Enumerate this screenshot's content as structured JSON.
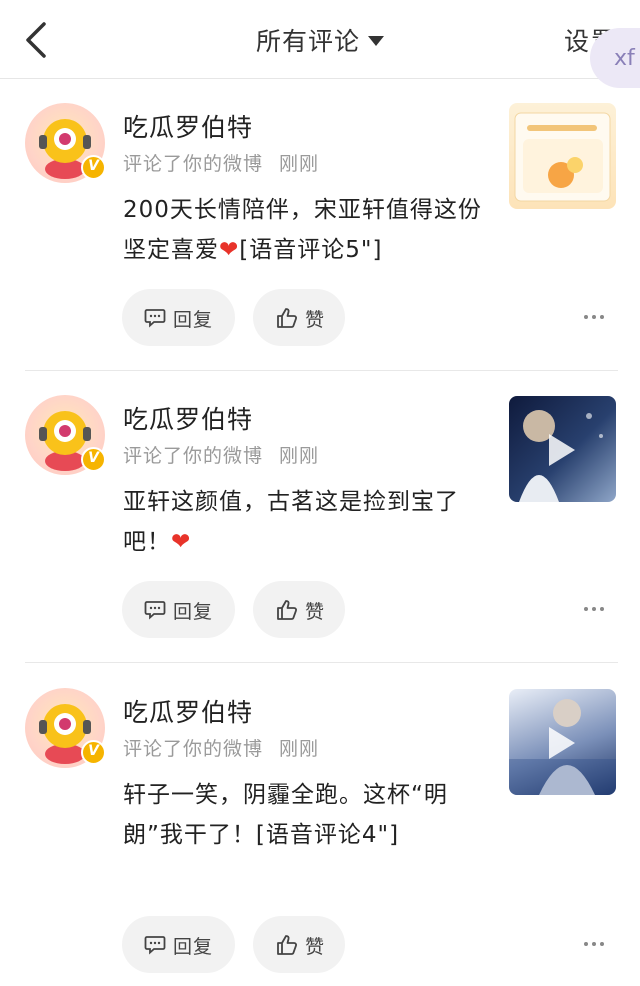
{
  "header": {
    "title": "所有评论",
    "settings_label": "设置",
    "floating_label": "xf"
  },
  "comments": [
    {
      "username": "吃瓜罗伯特",
      "action": "评论了你的微博",
      "time": "刚刚",
      "text": "200天长情陪伴，宋亚轩值得这份坚定喜爱",
      "emoji": "❤",
      "suffix": "[语音评论5\"]",
      "reply_label": "回复",
      "like_label": "赞"
    },
    {
      "username": "吃瓜罗伯特",
      "action": "评论了你的微博",
      "time": "刚刚",
      "text": "亚轩这颜值，古茗这是捡到宝了吧！",
      "emoji": "❤",
      "suffix": "",
      "reply_label": "回复",
      "like_label": "赞"
    },
    {
      "username": "吃瓜罗伯特",
      "action": "评论了你的微博",
      "time": "刚刚",
      "text": "轩子一笑，阴霾全跑。这杯“明朗”我干了！[语音评论4\"]",
      "emoji": "",
      "suffix": "",
      "reply_label": "回复",
      "like_label": "赞"
    }
  ],
  "colors": {
    "heart": "#e8332a",
    "badge": "#f6b400",
    "pill_bg": "#f2f2f2"
  }
}
